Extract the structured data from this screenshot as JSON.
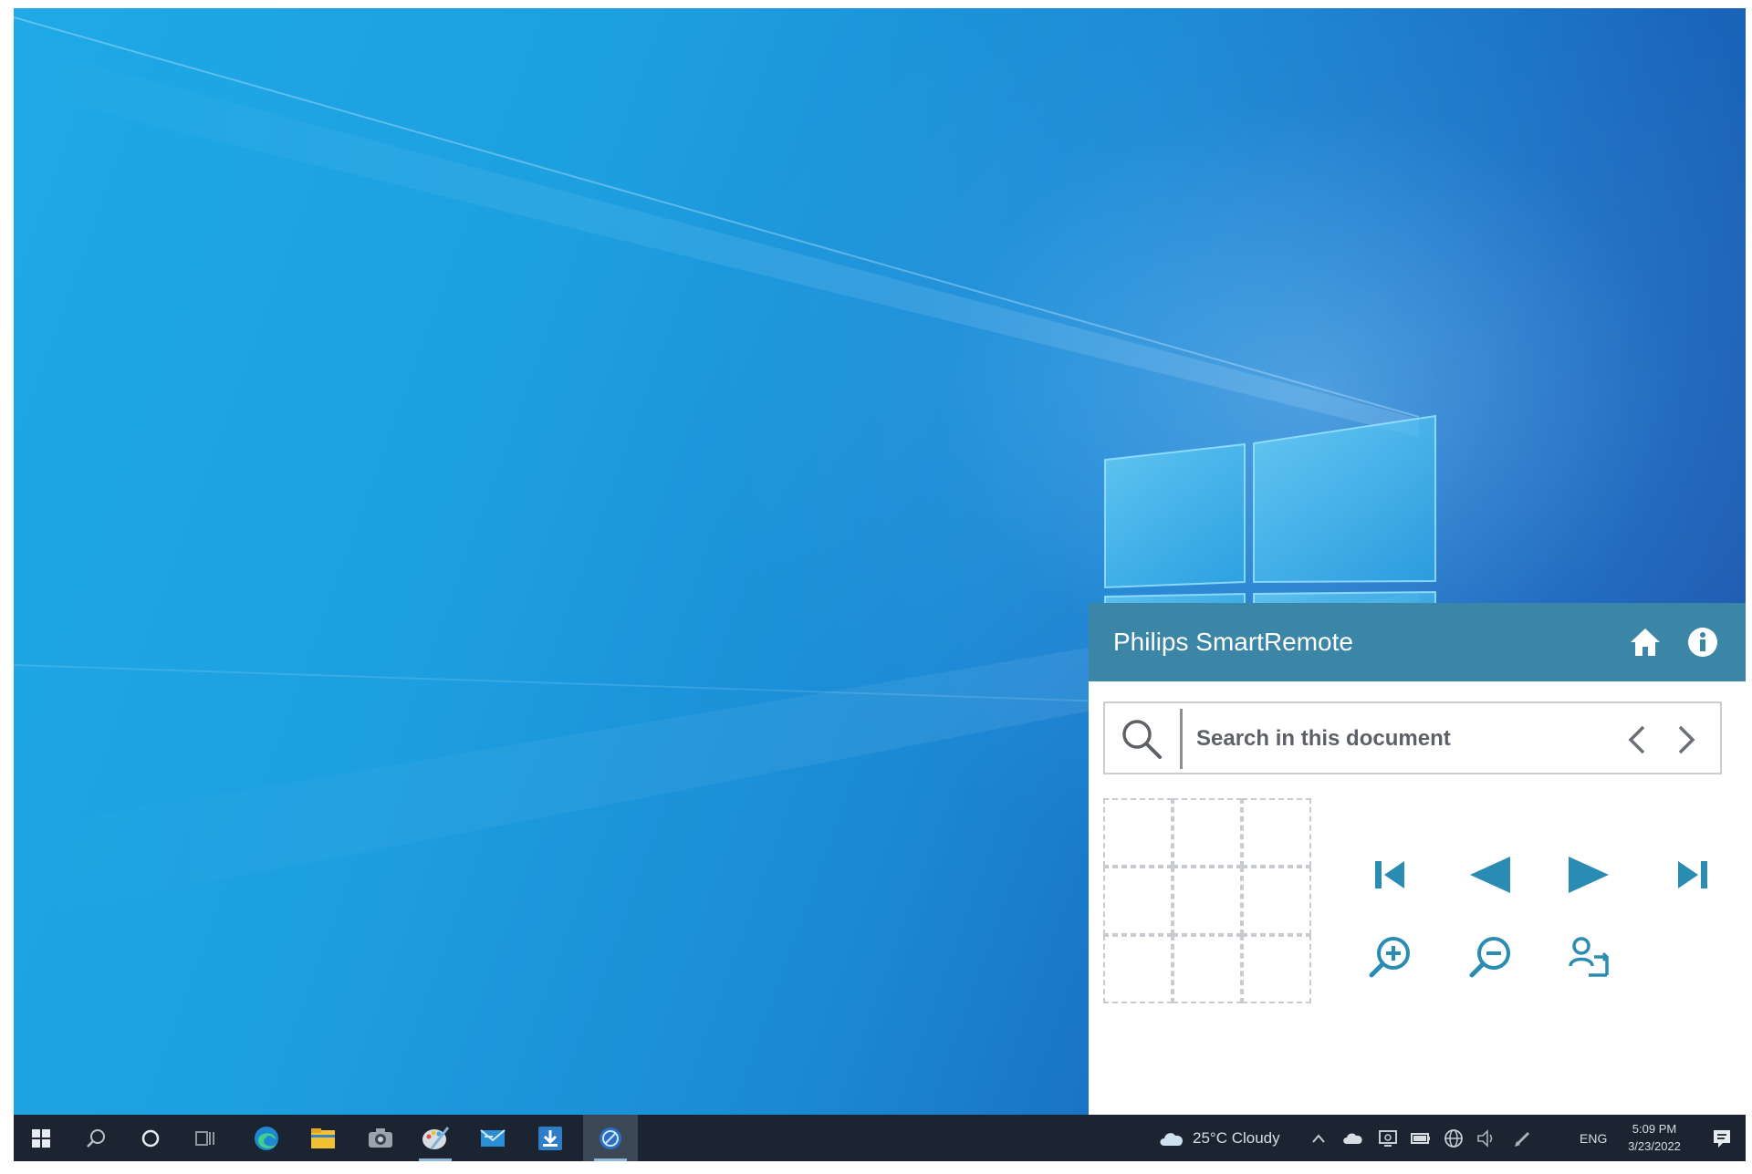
{
  "colors": {
    "wallpaper_light": "#1fa9e6",
    "wallpaper_dark": "#1f4fa6",
    "taskbar": "#1b2430",
    "panel_header": "#3b86a6",
    "accent_icon": "#2a8bb3"
  },
  "panel": {
    "title": "Philips SmartRemote",
    "header_icons": [
      "home-icon",
      "info-icon"
    ],
    "search": {
      "placeholder": "Search in this document",
      "value": ""
    },
    "touchpad": {
      "rows": 3,
      "cols": 3
    },
    "controls": {
      "row1": [
        "first-page-icon",
        "previous-page-icon",
        "next-page-icon",
        "last-page-icon"
      ],
      "row2": [
        "zoom-in-icon",
        "zoom-out-icon",
        "presenter-switch-icon"
      ]
    }
  },
  "taskbar": {
    "pinned": [
      "start-icon",
      "search-icon",
      "cortana-icon",
      "task-view-icon",
      "edge-icon",
      "file-explorer-icon",
      "camera-icon",
      "paint-icon",
      "mail-icon",
      "download-app-icon",
      "smartremote-app-icon"
    ],
    "weather": "25°C  Cloudy",
    "language": "ENG",
    "clock": {
      "time": "5:09 PM",
      "date": "3/23/2022"
    }
  }
}
